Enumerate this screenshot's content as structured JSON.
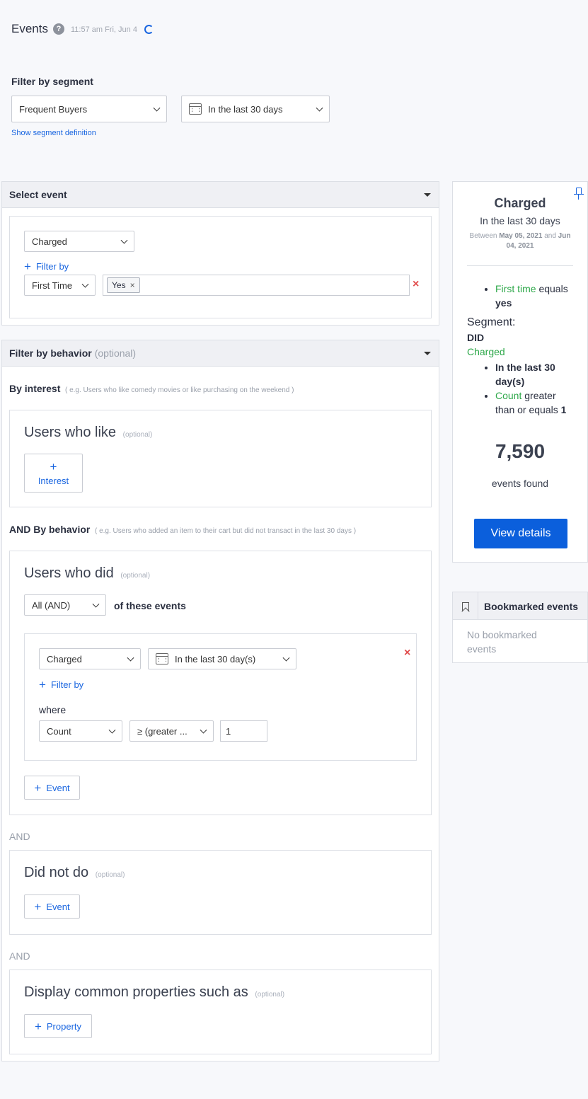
{
  "header": {
    "title": "Events",
    "timestamp": "11:57 am Fri, Jun 4"
  },
  "segment": {
    "label": "Filter by segment",
    "selected": "Frequent Buyers",
    "date_range": "In the last 30 days",
    "show_definition": "Show segment definition"
  },
  "select_event": {
    "title": "Select event",
    "event": "Charged",
    "filter_by": "Filter by",
    "filter_property": "First Time",
    "filter_tag": "Yes"
  },
  "behavior": {
    "title": "Filter by behavior",
    "optional": "(optional)",
    "by_interest": "By interest",
    "by_interest_hint": "( e.g. Users who like comedy movies or like purchasing on the weekend )",
    "users_who_like": "Users who like",
    "interest_button": "Interest",
    "and_by_behavior": "AND By behavior",
    "and_by_behavior_hint": "( e.g. Users who added an item to their cart but did not transact in the last 30 days )",
    "users_who_did": "Users who did",
    "match_mode": "All (AND)",
    "of_these_events": "of these events",
    "did_event": "Charged",
    "did_date": "In the last 30 day(s)",
    "filter_by": "Filter by",
    "where": "where",
    "where_metric": "Count",
    "where_operator": "≥  (greater ...",
    "where_value": "1",
    "event_button": "Event",
    "and_label": "AND",
    "did_not_do": "Did not do",
    "display_common": "Display common properties such as",
    "property_button": "Property"
  },
  "summary": {
    "event": "Charged",
    "range": "In the last 30 days",
    "between_prefix": "Between",
    "start_date": "May 05, 2021",
    "between_and": "and",
    "end_date": "Jun 04, 2021",
    "filter_prop": "First time",
    "filter_op": "equals",
    "filter_val": "yes",
    "segment_label": "Segment:",
    "segment_did": "DID",
    "segment_event": "Charged",
    "cond1": "In the last 30 day(s)",
    "cond2_prop": "Count",
    "cond2_op": "greater than or equals",
    "cond2_val": "1",
    "count": "7,590",
    "count_label": "events found",
    "view_details": "View details"
  },
  "bookmarks": {
    "title": "Bookmarked events",
    "empty": "No bookmarked events"
  }
}
